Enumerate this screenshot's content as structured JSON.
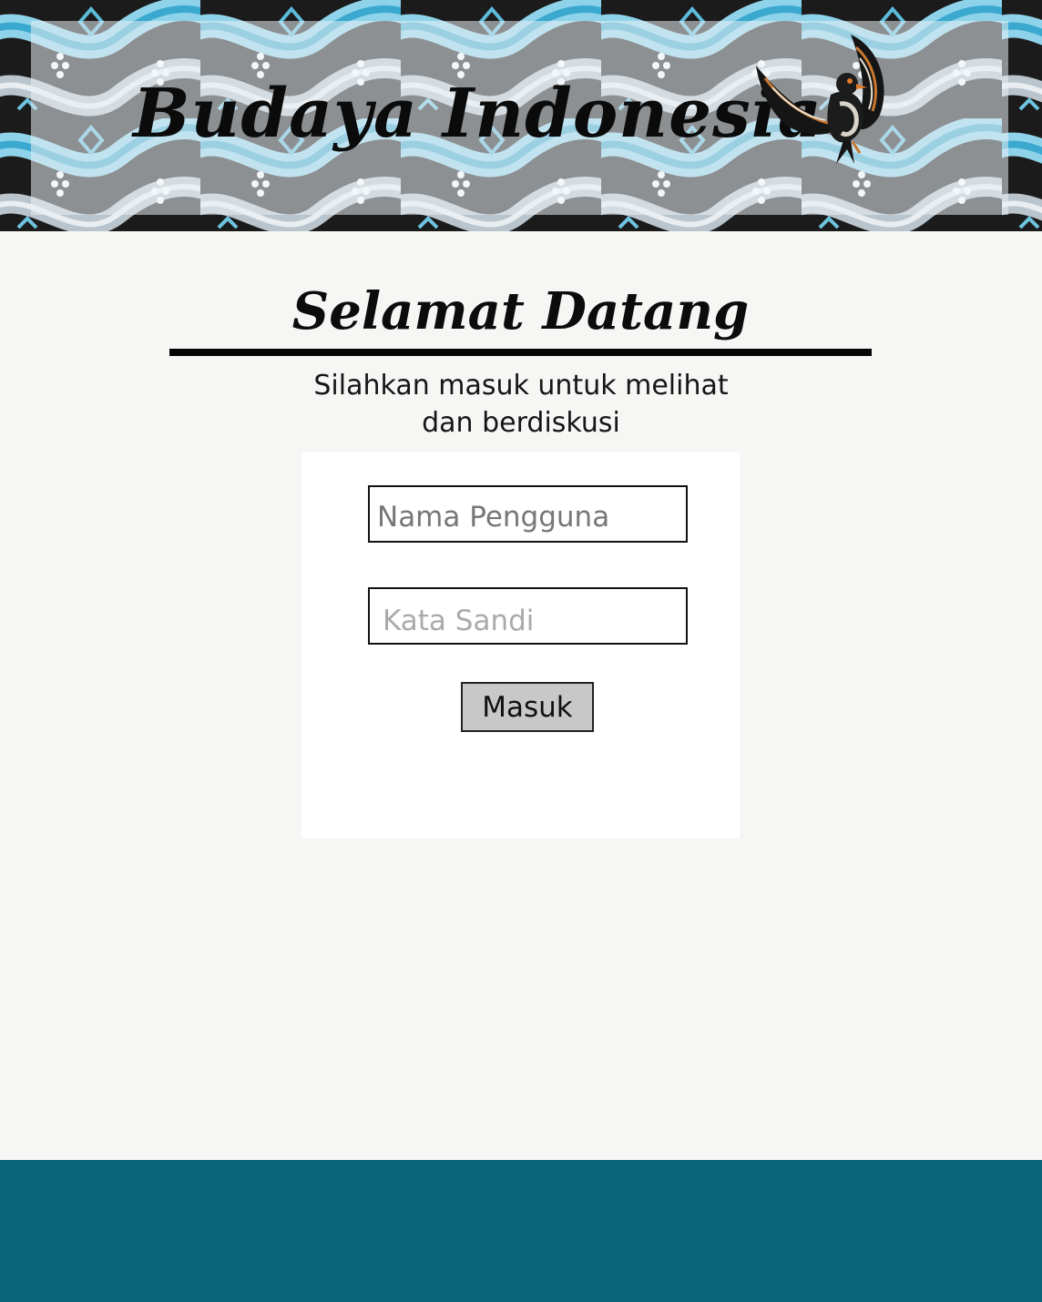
{
  "header": {
    "site_title": "Budaya Indonesia",
    "logo_icon": "garuda-bird-icon"
  },
  "welcome": {
    "heading": "Selamat Datang",
    "subtitle_line1": "Silahkan masuk untuk  melihat",
    "subtitle_line2": "dan berdiskusi"
  },
  "login_form": {
    "username_placeholder": "Nama Pengguna",
    "username_value": "",
    "password_placeholder": "Kata Sandi",
    "password_value": "",
    "submit_label": "Masuk"
  },
  "colors": {
    "page_background": "#f6f7f5",
    "card_background": "#ffffff",
    "footer": "#0b647c",
    "batik_light_blue": "#7fcbe3",
    "batik_dark": "#1a1a1a",
    "button_background": "#c8c8c8"
  }
}
